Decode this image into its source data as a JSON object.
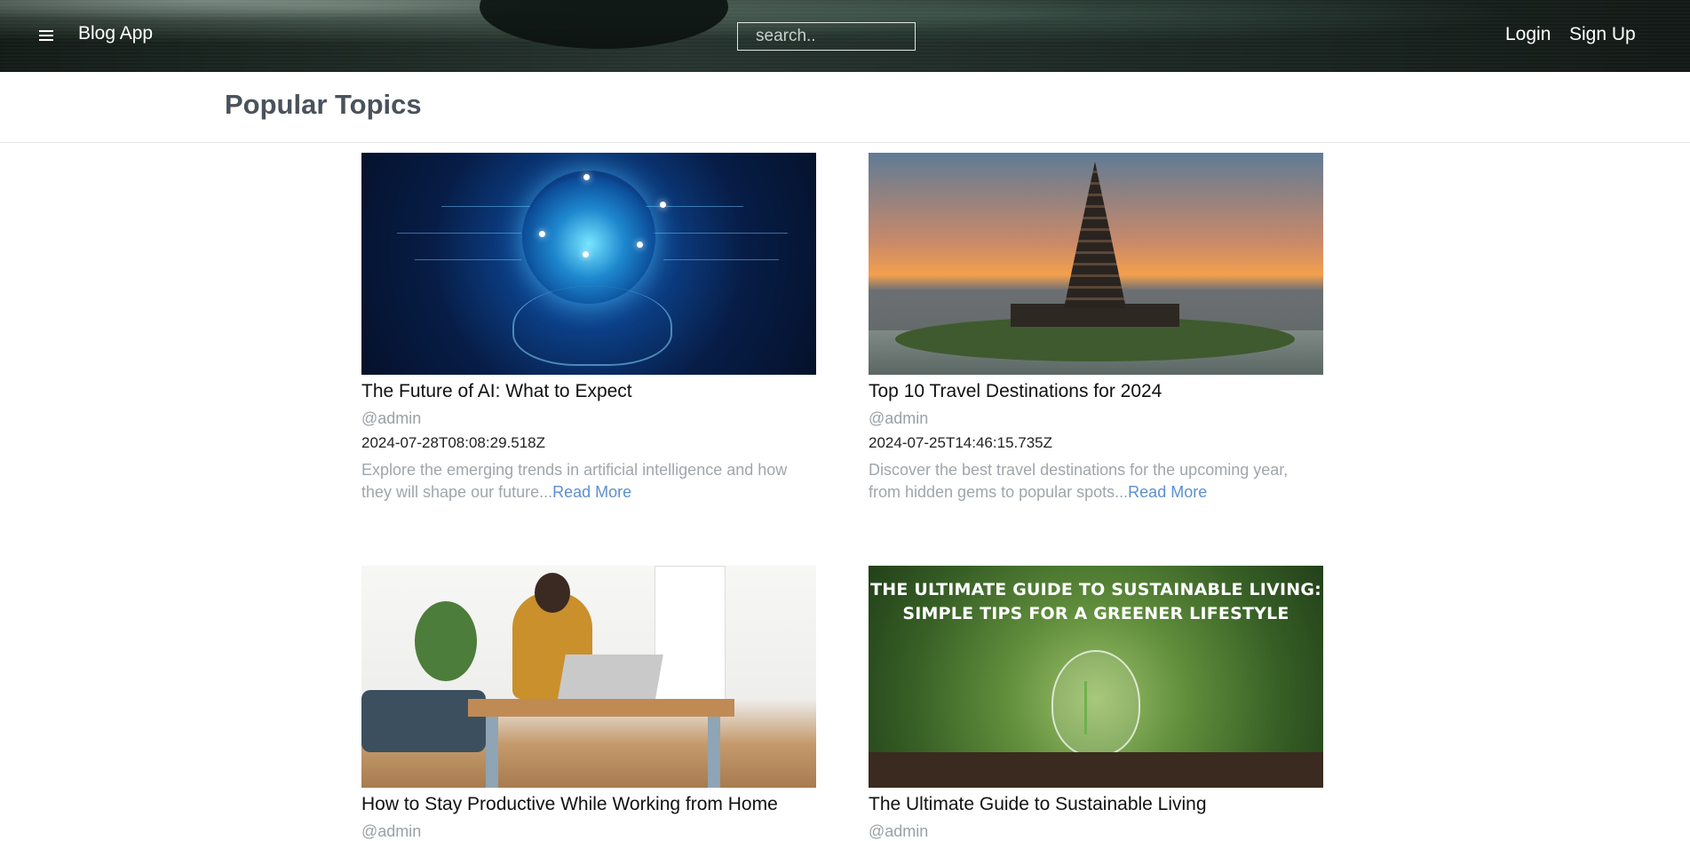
{
  "header": {
    "brand": "Blog App",
    "search_placeholder": "search..",
    "login_label": "Login",
    "signup_label": "Sign Up",
    "menu_icon": "hamburger-menu-icon"
  },
  "section": {
    "title": "Popular Topics"
  },
  "posts": [
    {
      "title": "The Future of AI: What to Expect",
      "author": "@admin",
      "date": "2024-07-28T08:08:29.518Z",
      "excerpt": "Explore the emerging trends in artificial intelligence and how they will shape our future...",
      "read_more": "Read More"
    },
    {
      "title": "Top 10 Travel Destinations for 2024",
      "author": "@admin",
      "date": "2024-07-25T14:46:15.735Z",
      "excerpt": "Discover the best travel destinations for the upcoming year, from hidden gems to popular spots...",
      "read_more": "Read More"
    },
    {
      "title": "How to Stay Productive While Working from Home",
      "author": "@admin"
    },
    {
      "title": "The Ultimate Guide to Sustainable Living",
      "author": "@admin",
      "image_text": "THE ULTIMATE GUIDE TO SUSTAINABLE LIVING: SIMPLE TIPS FOR A GREENER LIFESTYLE"
    }
  ]
}
